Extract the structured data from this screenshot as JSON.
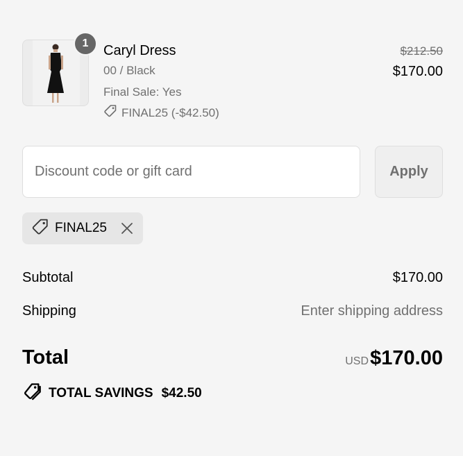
{
  "product": {
    "quantity": "1",
    "name": "Caryl Dress",
    "variant": "00 / Black",
    "final_sale": "Final Sale: Yes",
    "discount_line": "FINAL25 (-$42.50)",
    "compare_price": "$212.50",
    "price": "$170.00"
  },
  "discount": {
    "placeholder": "Discount code or gift card",
    "apply_label": "Apply",
    "applied_code": "FINAL25"
  },
  "summary": {
    "subtotal_label": "Subtotal",
    "subtotal_value": "$170.00",
    "shipping_label": "Shipping",
    "shipping_value": "Enter shipping address",
    "total_label": "Total",
    "currency": "USD",
    "total_value": "$170.00",
    "savings_label": "TOTAL SAVINGS",
    "savings_value": "$42.50"
  },
  "icons": {
    "tag": "tag-icon",
    "close": "close-icon",
    "savings": "savings-tags-icon"
  },
  "colors": {
    "background": "#f5f5f5",
    "muted_text": "#707070",
    "badge": "#666666",
    "tag_background": "#e6e6e6"
  }
}
